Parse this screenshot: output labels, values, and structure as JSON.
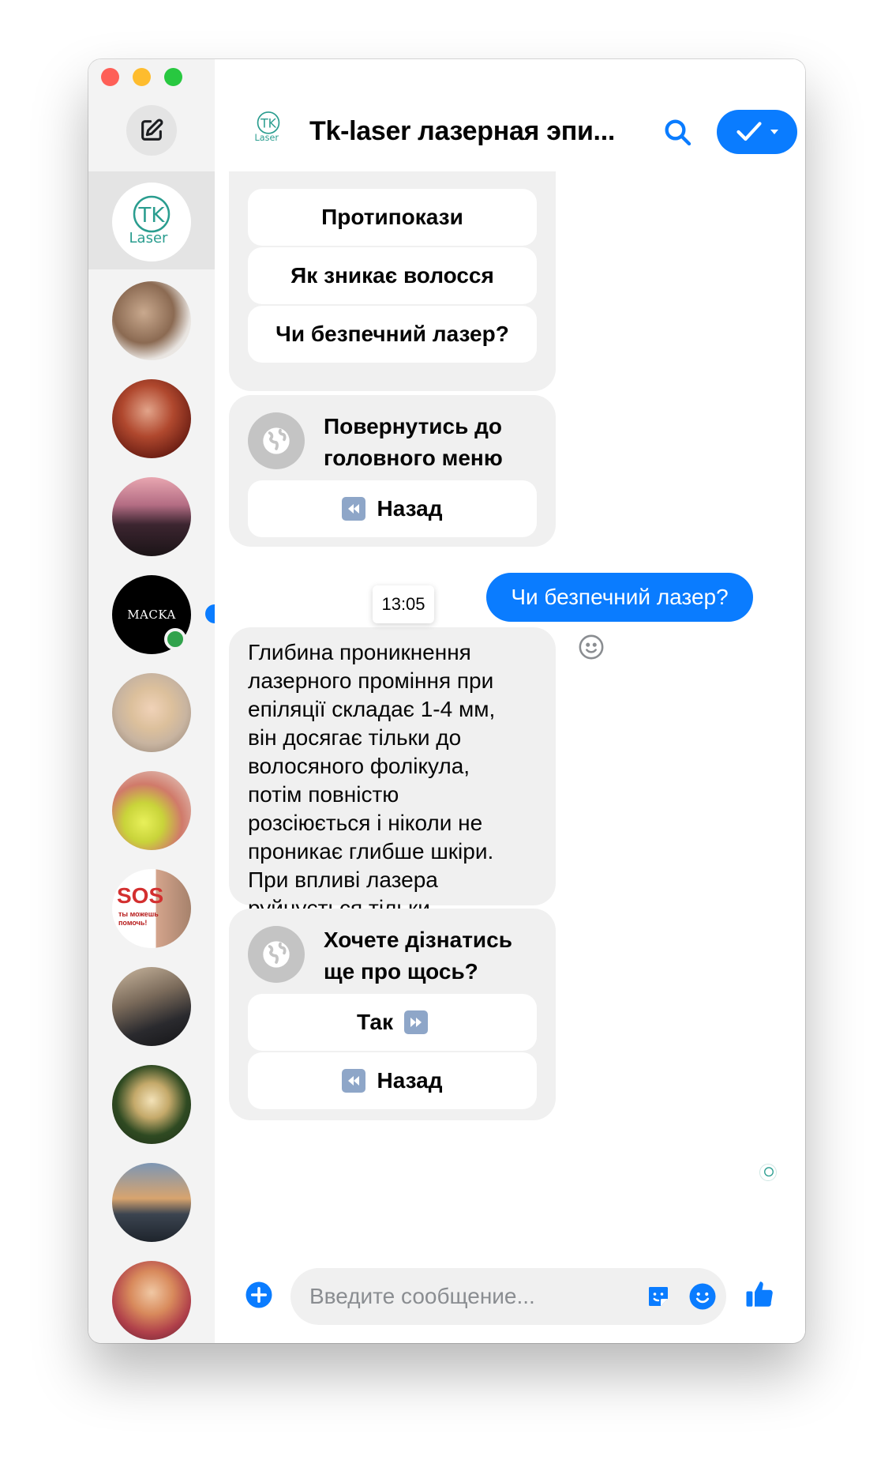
{
  "header": {
    "title": "Tk-laser лазерная эпи...",
    "logo_main": "TK",
    "logo_sub": "Laser"
  },
  "sidebar": {
    "selected_logo_main": "TK",
    "selected_logo_sub": "Laser",
    "maska_label": "MACKA",
    "sos_label": "SOS",
    "sos_sub": "ты можешь помочь!"
  },
  "chat": {
    "quick_replies_top": [
      "Протипокази",
      "Як зникає волосся",
      "Чи безпечний лазер?"
    ],
    "card1": {
      "text": "Повернутись до головного меню",
      "back_label": "Назад"
    },
    "outgoing_message": "Чи безпечний лазер?",
    "timestamp": "13:05",
    "incoming_message": "Глибина проникнення лазерного проміння при епіляції складає 1-4 мм, він досягає тільки до волосяного фолікула, потім повністю розсіюється і ніколи не проникає глибше шкіри. При впливі лазера руйнується тільки волосяна цибулина.",
    "card2": {
      "text": "Хочете дізнатись ще про щось?",
      "yes_label": "Так",
      "back_label": "Назад"
    }
  },
  "composer": {
    "placeholder": "Введите сообщение..."
  },
  "colors": {
    "accent": "#0a7cff",
    "bubble_incoming": "#f0f0f0",
    "logo_teal": "#2a9d8f"
  }
}
